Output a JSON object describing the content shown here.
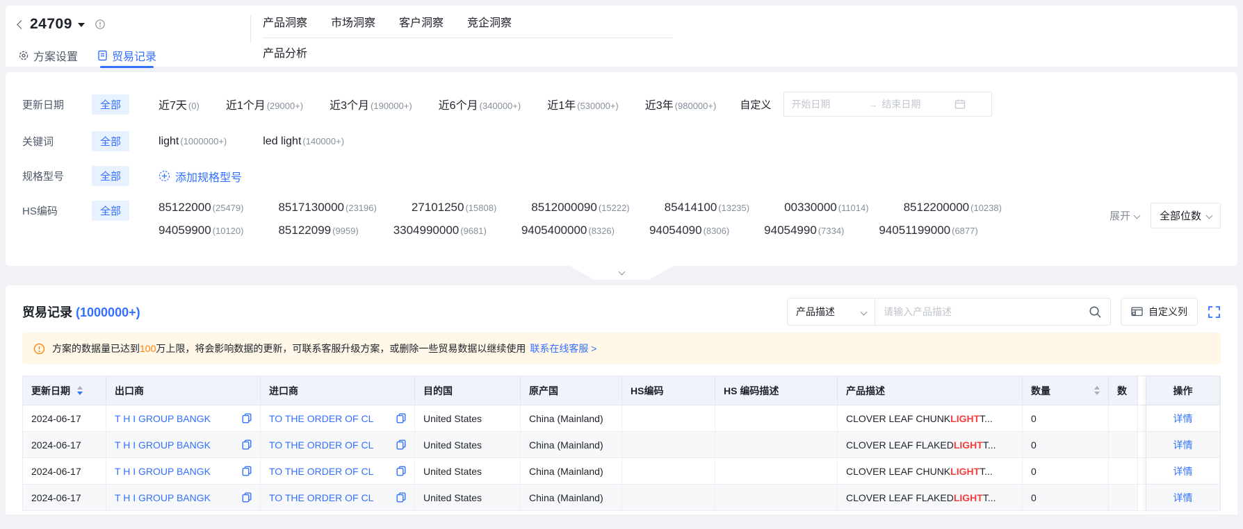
{
  "app": {
    "plan_id": "24709",
    "nav_tabs": [
      "产品洞察",
      "市场洞察",
      "客户洞察",
      "竞企洞察"
    ],
    "sub_tab": "产品分析",
    "left_tabs": [
      {
        "label": "方案设置",
        "active": false
      },
      {
        "label": "贸易记录",
        "active": true
      }
    ]
  },
  "filters": {
    "date": {
      "label": "更新日期",
      "all": "全部",
      "options": [
        {
          "text": "近7天",
          "count": "(0)"
        },
        {
          "text": "近1个月",
          "count": "(29000+)"
        },
        {
          "text": "近3个月",
          "count": "(190000+)"
        },
        {
          "text": "近6个月",
          "count": "(340000+)"
        },
        {
          "text": "近1年",
          "count": "(530000+)"
        },
        {
          "text": "近3年",
          "count": "(980000+)"
        }
      ],
      "custom": "自定义",
      "start_placeholder": "开始日期",
      "arrow": "→",
      "end_placeholder": "结束日期"
    },
    "keyword": {
      "label": "关键词",
      "all": "全部",
      "options": [
        {
          "text": "light",
          "count": "(1000000+)"
        },
        {
          "text": "led light",
          "count": "(140000+)"
        }
      ]
    },
    "spec": {
      "label": "规格型号",
      "all": "全部",
      "add_label": "添加规格型号"
    },
    "hs": {
      "label": "HS编码",
      "all": "全部",
      "row1": [
        {
          "code": "85122000",
          "count": "(25479)"
        },
        {
          "code": "8517130000",
          "count": "(23196)"
        },
        {
          "code": "27101250",
          "count": "(15808)"
        },
        {
          "code": "8512000090",
          "count": "(15222)"
        },
        {
          "code": "85414100",
          "count": "(13235)"
        },
        {
          "code": "00330000",
          "count": "(11014)"
        },
        {
          "code": "8512200000",
          "count": "(10238)"
        }
      ],
      "row2": [
        {
          "code": "94059900",
          "count": "(10120)"
        },
        {
          "code": "85122099",
          "count": "(9959)"
        },
        {
          "code": "3304990000",
          "count": "(9681)"
        },
        {
          "code": "9405400000",
          "count": "(8326)"
        },
        {
          "code": "94054090",
          "count": "(8306)"
        },
        {
          "code": "94054990",
          "count": "(7334)"
        },
        {
          "code": "94051199000",
          "count": "(6877)"
        }
      ],
      "expand": "展开",
      "digits": "全部位数"
    }
  },
  "records": {
    "title": "贸易记录",
    "count": "(1000000+)",
    "search_type": "产品描述",
    "search_placeholder": "请输入产品描述",
    "customize": "自定义列",
    "banner": {
      "pre": "方案的数据量已达到",
      "highlight": "100",
      "post": "万上限，将会影响数据的更新，可联系客服升级方案，或删除一些贸易数据以继续使用",
      "link": "联系在线客服 >"
    },
    "table": {
      "columns": [
        {
          "label": "更新日期",
          "sort": "desc"
        },
        {
          "label": "出口商"
        },
        {
          "label": "进口商"
        },
        {
          "label": "目的国"
        },
        {
          "label": "原产国"
        },
        {
          "label": "HS编码"
        },
        {
          "label": "HS 编码描述"
        },
        {
          "label": "产品描述"
        },
        {
          "label": "数量",
          "sort": "neutral"
        },
        {
          "label": "数"
        },
        {
          "label": "操作"
        }
      ],
      "rows": [
        {
          "date": "2024-06-17",
          "exporter": "T H I GROUP BANGK",
          "importer": "TO THE ORDER OF CL",
          "destination": "United States",
          "origin": "China (Mainland)",
          "hs_code": "",
          "hs_desc": "",
          "desc_pre": "CLOVER LEAF CHUNK ",
          "desc_highlight": "LIGHT",
          "desc_post": " T...",
          "quantity": "0",
          "qty2": "",
          "action": "详情"
        },
        {
          "date": "2024-06-17",
          "exporter": "T H I GROUP BANGK",
          "importer": "TO THE ORDER OF CL",
          "destination": "United States",
          "origin": "China (Mainland)",
          "hs_code": "",
          "hs_desc": "",
          "desc_pre": "CLOVER LEAF FLAKED ",
          "desc_highlight": "LIGHT",
          "desc_post": " T...",
          "quantity": "0",
          "qty2": "",
          "action": "详情"
        },
        {
          "date": "2024-06-17",
          "exporter": "T H I GROUP BANGK",
          "importer": "TO THE ORDER OF CL",
          "destination": "United States",
          "origin": "China (Mainland)",
          "hs_code": "",
          "hs_desc": "",
          "desc_pre": "CLOVER LEAF CHUNK ",
          "desc_highlight": "LIGHT",
          "desc_post": " T...",
          "quantity": "0",
          "qty2": "",
          "action": "详情"
        },
        {
          "date": "2024-06-17",
          "exporter": "T H I GROUP BANGK",
          "importer": "TO THE ORDER OF CL",
          "destination": "United States",
          "origin": "China (Mainland)",
          "hs_code": "",
          "hs_desc": "",
          "desc_pre": "CLOVER LEAF FLAKED ",
          "desc_highlight": "LIGHT",
          "desc_post": " T...",
          "quantity": "0",
          "qty2": "",
          "action": "详情"
        }
      ]
    }
  },
  "icons": {
    "back": "chevron-left",
    "plan_dropdown": "caret-down",
    "info": "circle-exclamation",
    "plan_settings": "gear",
    "trade_records": "document",
    "add_spec": "dashed-circle-plus",
    "date_range": "calendar",
    "search": "magnifier",
    "customize_columns": "table-gear",
    "fullscreen": "expand-corners",
    "warning": "circle-exclamation",
    "copy": "copy",
    "collapse": "chevron-down"
  },
  "colors": {
    "primary_blue": "#3370FF",
    "chip_bg": "#E8F1FF",
    "warning_orange": "#FF7D00",
    "banner_bg": "#FFF7E8",
    "highlight_red": "#F53F3F",
    "table_header_bg": "#F1F3FA"
  }
}
